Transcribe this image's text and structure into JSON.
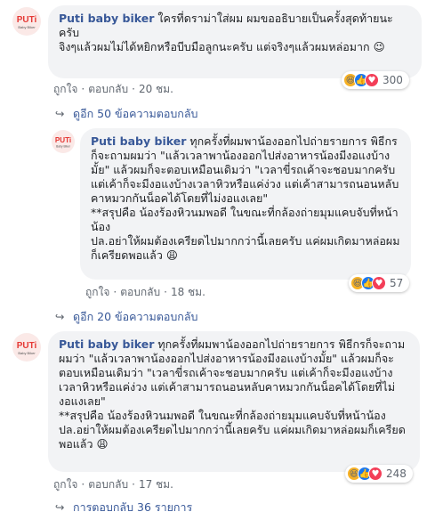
{
  "comments": [
    {
      "author": "Puti baby biker",
      "avatar_text": "PUTi",
      "avatar_sub": "Baby Biker",
      "text": "ใครที่ดราม่าใส่ผม ผมขออธิบายเป็นครั้งสุดท้ายนะครับ\nจิงๆแล้วผมไม่ได้หยิกหรือบีบมือลูกนะครับ แต่จริงๆแล้วผมหล่อมาก 😉",
      "like": "ถูกใจ",
      "reply": "ตอบกลับ",
      "time": "20 ชม.",
      "reaction_count": "300"
    },
    {
      "author": "Puti baby biker",
      "avatar_text": "PUTi",
      "avatar_sub": "Baby Biker",
      "text": "ทุกครั้งที่ผมพาน้องออกไปถ่ายรายการ พิธีกรก็จะถามผมว่า \"แล้วเวลาพาน้องออกไปส่งอาหารน้องมีงอแงบ้างมั้ย\" แล้วผมก็จะตอบเหมือนเดิมว่า \"เวลาขี่รถเค้าจะชอบมากครับ แต่เค้าก็จะมีงอแงบ้างเวลาหิวหรือแค่ง่วง แต่เค้าสามารถนอนหลับคาหมวกกันน็อคได้โดยที่ไม่งอแงเลย\"\n**สรุปคือ น้องร้องหิวนมพอดี ในขณะที่กล้องถ่ายมุมแคบจับที่หน้าน้อง\nปล.อย่าให้ผมต้องเครียดไปมากกว่านี้เลยครับ แค่ผมเกิดมาหล่อผมก็เครียดพอแล้ว 😩",
      "like": "ถูกใจ",
      "reply": "ตอบกลับ",
      "time": "18 ชม.",
      "reaction_count": "57"
    },
    {
      "author": "Puti baby biker",
      "avatar_text": "PUTi",
      "avatar_sub": "Baby Biker",
      "text": "ทุกครั้งที่ผมพาน้องออกไปถ่ายรายการ พิธีกรก็จะถามผมว่า \"แล้วเวลาพาน้องออกไปส่งอาหารน้องมีงอแงบ้างมั้ย\" แล้วผมก็จะตอบเหมือนเดิมว่า \"เวลาขี่รถเค้าจะชอบมากครับ แต่เค้าก็จะมีงอแงบ้างเวลาหิวหรือแค่ง่วง แต่เค้าสามารถนอนหลับคาหมวกกันน็อคได้โดยที่ไม่งอแงเลย\"\n**สรุปคือ น้องร้องหิวนมพอดี ในขณะที่กล้องถ่ายมุมแคบจับที่หน้าน้อง\nปล.อย่าให้ผมต้องเครียดไปมากกว่านี้เลยครับ แค่ผมเกิดมาหล่อผมก็เครียดพอแล้ว 😩",
      "like": "ถูกใจ",
      "reply": "ตอบกลับ",
      "time": "17 ชม.",
      "reaction_count": "248"
    }
  ],
  "view_replies_1": "ดูอีก 50 ข้อความตอบกลับ",
  "view_replies_2": "ดูอีก 20 ข้อความตอบกลับ",
  "view_replies_3": "การตอบกลับ 36 รายการ",
  "reactions": [
    {
      "name": "haha-icon",
      "glyph": "😆",
      "color": "#f7b125"
    },
    {
      "name": "like-icon",
      "glyph": "👍",
      "color": "#1877f2"
    },
    {
      "name": "love-icon",
      "glyph": "♥",
      "color": "#f33e58"
    }
  ],
  "colors": {
    "name": "#385898",
    "bubble": "#f2f3f5",
    "meta": "#606770"
  }
}
